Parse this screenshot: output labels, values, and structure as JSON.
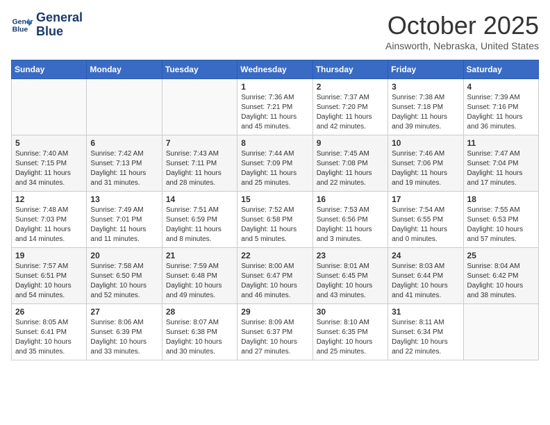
{
  "header": {
    "logo_line1": "General",
    "logo_line2": "Blue",
    "month": "October 2025",
    "location": "Ainsworth, Nebraska, United States"
  },
  "days_of_week": [
    "Sunday",
    "Monday",
    "Tuesday",
    "Wednesday",
    "Thursday",
    "Friday",
    "Saturday"
  ],
  "weeks": [
    [
      {
        "num": "",
        "data": ""
      },
      {
        "num": "",
        "data": ""
      },
      {
        "num": "",
        "data": ""
      },
      {
        "num": "1",
        "data": "Sunrise: 7:36 AM\nSunset: 7:21 PM\nDaylight: 11 hours and 45 minutes."
      },
      {
        "num": "2",
        "data": "Sunrise: 7:37 AM\nSunset: 7:20 PM\nDaylight: 11 hours and 42 minutes."
      },
      {
        "num": "3",
        "data": "Sunrise: 7:38 AM\nSunset: 7:18 PM\nDaylight: 11 hours and 39 minutes."
      },
      {
        "num": "4",
        "data": "Sunrise: 7:39 AM\nSunset: 7:16 PM\nDaylight: 11 hours and 36 minutes."
      }
    ],
    [
      {
        "num": "5",
        "data": "Sunrise: 7:40 AM\nSunset: 7:15 PM\nDaylight: 11 hours and 34 minutes."
      },
      {
        "num": "6",
        "data": "Sunrise: 7:42 AM\nSunset: 7:13 PM\nDaylight: 11 hours and 31 minutes."
      },
      {
        "num": "7",
        "data": "Sunrise: 7:43 AM\nSunset: 7:11 PM\nDaylight: 11 hours and 28 minutes."
      },
      {
        "num": "8",
        "data": "Sunrise: 7:44 AM\nSunset: 7:09 PM\nDaylight: 11 hours and 25 minutes."
      },
      {
        "num": "9",
        "data": "Sunrise: 7:45 AM\nSunset: 7:08 PM\nDaylight: 11 hours and 22 minutes."
      },
      {
        "num": "10",
        "data": "Sunrise: 7:46 AM\nSunset: 7:06 PM\nDaylight: 11 hours and 19 minutes."
      },
      {
        "num": "11",
        "data": "Sunrise: 7:47 AM\nSunset: 7:04 PM\nDaylight: 11 hours and 17 minutes."
      }
    ],
    [
      {
        "num": "12",
        "data": "Sunrise: 7:48 AM\nSunset: 7:03 PM\nDaylight: 11 hours and 14 minutes."
      },
      {
        "num": "13",
        "data": "Sunrise: 7:49 AM\nSunset: 7:01 PM\nDaylight: 11 hours and 11 minutes."
      },
      {
        "num": "14",
        "data": "Sunrise: 7:51 AM\nSunset: 6:59 PM\nDaylight: 11 hours and 8 minutes."
      },
      {
        "num": "15",
        "data": "Sunrise: 7:52 AM\nSunset: 6:58 PM\nDaylight: 11 hours and 5 minutes."
      },
      {
        "num": "16",
        "data": "Sunrise: 7:53 AM\nSunset: 6:56 PM\nDaylight: 11 hours and 3 minutes."
      },
      {
        "num": "17",
        "data": "Sunrise: 7:54 AM\nSunset: 6:55 PM\nDaylight: 11 hours and 0 minutes."
      },
      {
        "num": "18",
        "data": "Sunrise: 7:55 AM\nSunset: 6:53 PM\nDaylight: 10 hours and 57 minutes."
      }
    ],
    [
      {
        "num": "19",
        "data": "Sunrise: 7:57 AM\nSunset: 6:51 PM\nDaylight: 10 hours and 54 minutes."
      },
      {
        "num": "20",
        "data": "Sunrise: 7:58 AM\nSunset: 6:50 PM\nDaylight: 10 hours and 52 minutes."
      },
      {
        "num": "21",
        "data": "Sunrise: 7:59 AM\nSunset: 6:48 PM\nDaylight: 10 hours and 49 minutes."
      },
      {
        "num": "22",
        "data": "Sunrise: 8:00 AM\nSunset: 6:47 PM\nDaylight: 10 hours and 46 minutes."
      },
      {
        "num": "23",
        "data": "Sunrise: 8:01 AM\nSunset: 6:45 PM\nDaylight: 10 hours and 43 minutes."
      },
      {
        "num": "24",
        "data": "Sunrise: 8:03 AM\nSunset: 6:44 PM\nDaylight: 10 hours and 41 minutes."
      },
      {
        "num": "25",
        "data": "Sunrise: 8:04 AM\nSunset: 6:42 PM\nDaylight: 10 hours and 38 minutes."
      }
    ],
    [
      {
        "num": "26",
        "data": "Sunrise: 8:05 AM\nSunset: 6:41 PM\nDaylight: 10 hours and 35 minutes."
      },
      {
        "num": "27",
        "data": "Sunrise: 8:06 AM\nSunset: 6:39 PM\nDaylight: 10 hours and 33 minutes."
      },
      {
        "num": "28",
        "data": "Sunrise: 8:07 AM\nSunset: 6:38 PM\nDaylight: 10 hours and 30 minutes."
      },
      {
        "num": "29",
        "data": "Sunrise: 8:09 AM\nSunset: 6:37 PM\nDaylight: 10 hours and 27 minutes."
      },
      {
        "num": "30",
        "data": "Sunrise: 8:10 AM\nSunset: 6:35 PM\nDaylight: 10 hours and 25 minutes."
      },
      {
        "num": "31",
        "data": "Sunrise: 8:11 AM\nSunset: 6:34 PM\nDaylight: 10 hours and 22 minutes."
      },
      {
        "num": "",
        "data": ""
      }
    ]
  ]
}
